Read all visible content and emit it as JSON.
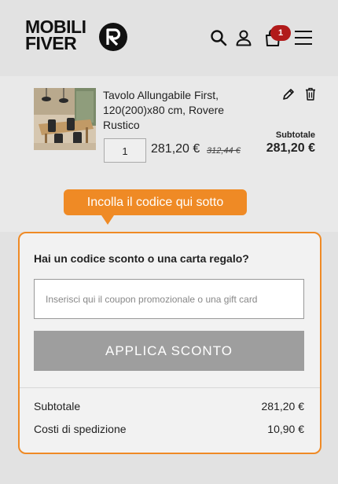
{
  "header": {
    "logo_line1": "MOBILI",
    "logo_line2": "FIVER",
    "cart_count": "1"
  },
  "cart_item": {
    "title": "Tavolo Allungabile First, 120(200)x80 cm, Rovere Rustico",
    "quantity": "1",
    "price": "281,20 €",
    "old_price": "312,44 €",
    "subtotal_label": "Subtotale",
    "subtotal_value": "281,20 €"
  },
  "tooltip": {
    "text": "Incolla il codice qui sotto"
  },
  "discount": {
    "question": "Hai un codice sconto o una carta regalo?",
    "placeholder": "Inserisci qui il coupon promozionale o una gift card",
    "apply_label": "APPLICA SCONTO"
  },
  "summary": {
    "rows": [
      {
        "label": "Subtotale",
        "value": "281,20 €"
      },
      {
        "label": "Costi di spedizione",
        "value": "10,90 €"
      }
    ]
  },
  "colors": {
    "accent": "#ef8a25",
    "badge": "#b11a1a",
    "button_disabled": "#9e9e9e"
  }
}
